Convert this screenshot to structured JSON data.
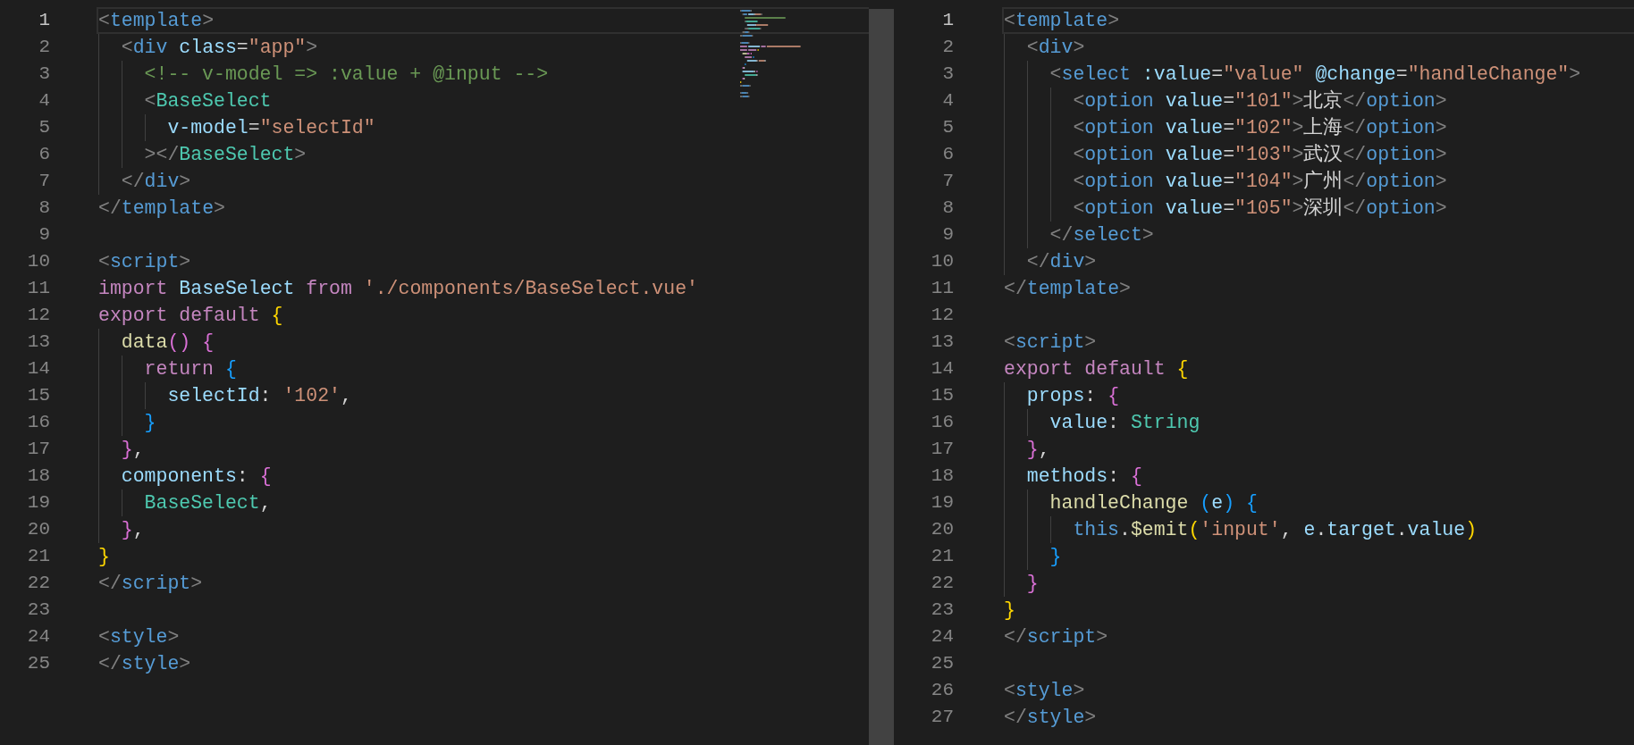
{
  "panes": [
    {
      "minimap": true,
      "lines": [
        {
          "number": "1",
          "active": true,
          "text": "<template>"
        },
        {
          "number": "2",
          "active": false,
          "text": "  <div class=\"app\">"
        },
        {
          "number": "3",
          "active": false,
          "text": "    <!-- v-model => :value + @input -->"
        },
        {
          "number": "4",
          "active": false,
          "text": "    <BaseSelect"
        },
        {
          "number": "5",
          "active": false,
          "text": "      v-model=\"selectId\""
        },
        {
          "number": "6",
          "active": false,
          "text": "    ></BaseSelect>"
        },
        {
          "number": "7",
          "active": false,
          "text": "  </div>"
        },
        {
          "number": "8",
          "active": false,
          "text": "</template>"
        },
        {
          "number": "9",
          "active": false
        },
        {
          "number": "10",
          "active": false,
          "text": "<script>"
        },
        {
          "number": "11",
          "active": false,
          "text": "import BaseSelect from './components/BaseSelect.vue'"
        },
        {
          "number": "12",
          "active": false,
          "text": "export default {"
        },
        {
          "number": "13",
          "active": false,
          "text": "  data() {"
        },
        {
          "number": "14",
          "active": false,
          "text": "    return {"
        },
        {
          "number": "15",
          "active": false,
          "text": "      selectId: '102',"
        },
        {
          "number": "16",
          "active": false,
          "text": "    }"
        },
        {
          "number": "17",
          "active": false,
          "text": "  },"
        },
        {
          "number": "18",
          "active": false,
          "text": "  components: {"
        },
        {
          "number": "19",
          "active": false,
          "text": "    BaseSelect,"
        },
        {
          "number": "20",
          "active": false,
          "text": "  },"
        },
        {
          "number": "21",
          "active": false,
          "text": "}"
        },
        {
          "number": "22",
          "active": false,
          "text": "</script>"
        },
        {
          "number": "23",
          "active": false
        },
        {
          "number": "24",
          "active": false,
          "text": "<style>"
        },
        {
          "number": "25",
          "active": false,
          "text": "</style>"
        }
      ]
    },
    {
      "lines": [
        {
          "number": "1",
          "active": true,
          "text": "<template>"
        },
        {
          "number": "2",
          "active": false,
          "text": "  <div>"
        },
        {
          "number": "3",
          "active": false,
          "text": "    <select :value=\"value\" @change=\"handleChange\">"
        },
        {
          "number": "4",
          "active": false,
          "text": "      <option value=\"101\">北京</option>"
        },
        {
          "number": "5",
          "active": false,
          "text": "      <option value=\"102\">上海</option>"
        },
        {
          "number": "6",
          "active": false,
          "text": "      <option value=\"103\">武汉</option>"
        },
        {
          "number": "7",
          "active": false,
          "text": "      <option value=\"104\">广州</option>"
        },
        {
          "number": "8",
          "active": false,
          "text": "      <option value=\"105\">深圳</option>"
        },
        {
          "number": "9",
          "active": false,
          "text": "    </select>"
        },
        {
          "number": "10",
          "active": false,
          "text": "  </div>"
        },
        {
          "number": "11",
          "active": false,
          "text": "</template>"
        },
        {
          "number": "12",
          "active": false
        },
        {
          "number": "13",
          "active": false,
          "text": "<script>"
        },
        {
          "number": "14",
          "active": false,
          "text": "export default {"
        },
        {
          "number": "15",
          "active": false,
          "text": "  props: {"
        },
        {
          "number": "16",
          "active": false,
          "text": "    value: String"
        },
        {
          "number": "17",
          "active": false,
          "text": "  },"
        },
        {
          "number": "18",
          "active": false,
          "text": "  methods: {"
        },
        {
          "number": "19",
          "active": false,
          "text": "    handleChange (e) {"
        },
        {
          "number": "20",
          "active": false,
          "text": "      this.$emit('input', e.target.value)"
        },
        {
          "number": "21",
          "active": false,
          "text": "    }"
        },
        {
          "number": "22",
          "active": false,
          "text": "  }"
        },
        {
          "number": "23",
          "active": false,
          "text": "}"
        },
        {
          "number": "24",
          "active": false,
          "text": "</script>"
        },
        {
          "number": "25",
          "active": false
        },
        {
          "number": "26",
          "active": false,
          "text": "<style>"
        },
        {
          "number": "27",
          "active": false,
          "text": "</style>"
        }
      ]
    }
  ]
}
